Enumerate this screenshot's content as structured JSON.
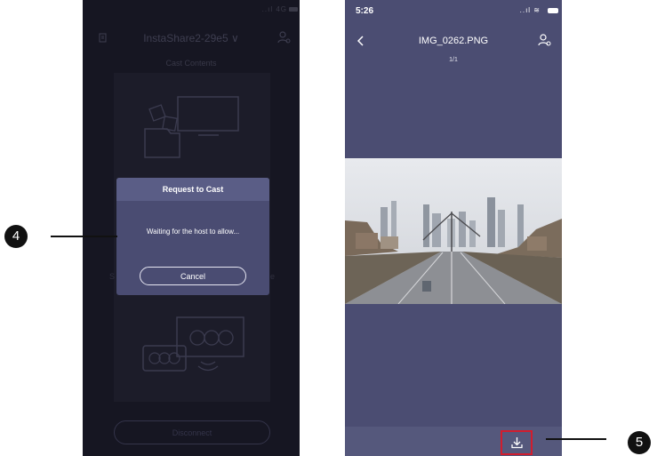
{
  "left_phone": {
    "status": {
      "signal": "..ıl 4G"
    },
    "nav": {
      "title": "InstaShare2-29e5",
      "chevron": "∨"
    },
    "cast_label": "Cast Contents",
    "side_left": "S",
    "side_right": "e",
    "dialog": {
      "title": "Request to Cast",
      "message": "Waiting for the host to allow...",
      "cancel_label": "Cancel"
    },
    "disconnect_label": "Disconnect"
  },
  "right_phone": {
    "status": {
      "time": "5:26"
    },
    "nav": {
      "title": "IMG_0262.PNG"
    },
    "counter": "1/1"
  },
  "callouts": {
    "left": "4",
    "right": "5"
  },
  "colors": {
    "highlight": "#d11d2e",
    "dialog": "#4a4c72",
    "phone_bg_right": "#4b4d72"
  },
  "icons": [
    "note-icon",
    "user-settings-icon",
    "back-icon",
    "download-icon"
  ]
}
